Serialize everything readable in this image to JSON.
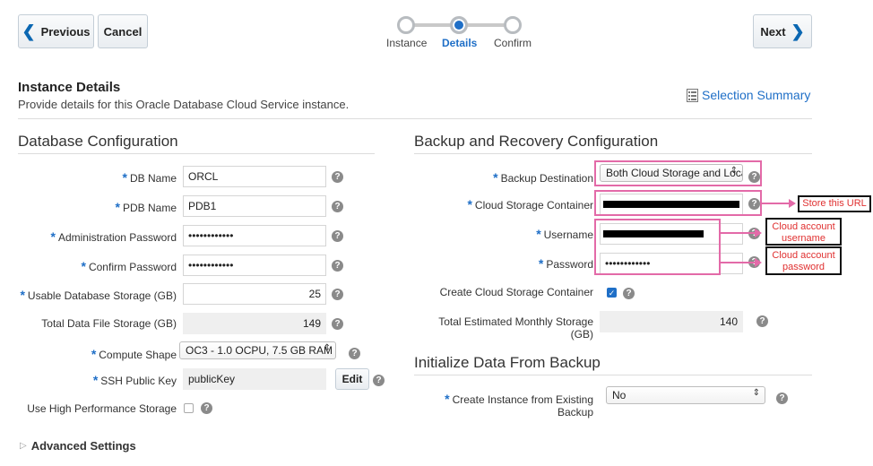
{
  "toolbar": {
    "previous_label": "Previous",
    "cancel_label": "Cancel",
    "next_label": "Next"
  },
  "train": {
    "steps": [
      {
        "label": "Instance"
      },
      {
        "label": "Details"
      },
      {
        "label": "Confirm"
      }
    ]
  },
  "header": {
    "title": "Instance Details",
    "subtitle": "Provide details for this Oracle Database Cloud Service instance.",
    "summary_link": "Selection Summary"
  },
  "db_config": {
    "title": "Database Configuration",
    "db_name": {
      "label": "DB Name",
      "value": "ORCL"
    },
    "pdb_name": {
      "label": "PDB Name",
      "value": "PDB1"
    },
    "admin_password": {
      "label": "Administration Password",
      "value": "••••••••••••"
    },
    "confirm_password": {
      "label": "Confirm Password",
      "value": "••••••••••••"
    },
    "usable_storage": {
      "label": "Usable Database Storage (GB)",
      "value": "25"
    },
    "total_storage": {
      "label": "Total Data File Storage (GB)",
      "value": "149"
    },
    "compute_shape": {
      "label": "Compute Shape",
      "value": "OC3 - 1.0 OCPU, 7.5 GB RAM"
    },
    "ssh_key": {
      "label": "SSH Public Key",
      "value": "publicKey",
      "edit_label": "Edit"
    },
    "high_perf": {
      "label": "Use High Performance Storage"
    }
  },
  "advanced": {
    "label": "Advanced Settings"
  },
  "backup": {
    "title": "Backup and Recovery Configuration",
    "destination": {
      "label": "Backup Destination",
      "value": "Both Cloud Storage and Loca"
    },
    "container": {
      "label": "Cloud Storage Container"
    },
    "username": {
      "label": "Username"
    },
    "password": {
      "label": "Password",
      "value": "••••••••••••"
    },
    "create_container": {
      "label": "Create Cloud Storage Container"
    },
    "monthly_storage": {
      "label": "Total Estimated Monthly Storage (GB)",
      "value": "140"
    }
  },
  "init": {
    "title": "Initialize Data From Backup",
    "existing": {
      "label": "Create Instance from Existing Backup",
      "value": "No"
    }
  },
  "annotations": {
    "url_note": "Store this URL",
    "username_note": "Cloud account username",
    "password_note": "Cloud account password"
  },
  "icons": {
    "help": "?",
    "chevron_left": "❮",
    "chevron_right": "❯",
    "select_arrow": "⇕",
    "check": "✓",
    "triangle_right": "▷"
  },
  "colors": {
    "accent": "#1f6fc7",
    "annotation_pink": "#e36aa8",
    "annotation_red": "#e03030"
  }
}
